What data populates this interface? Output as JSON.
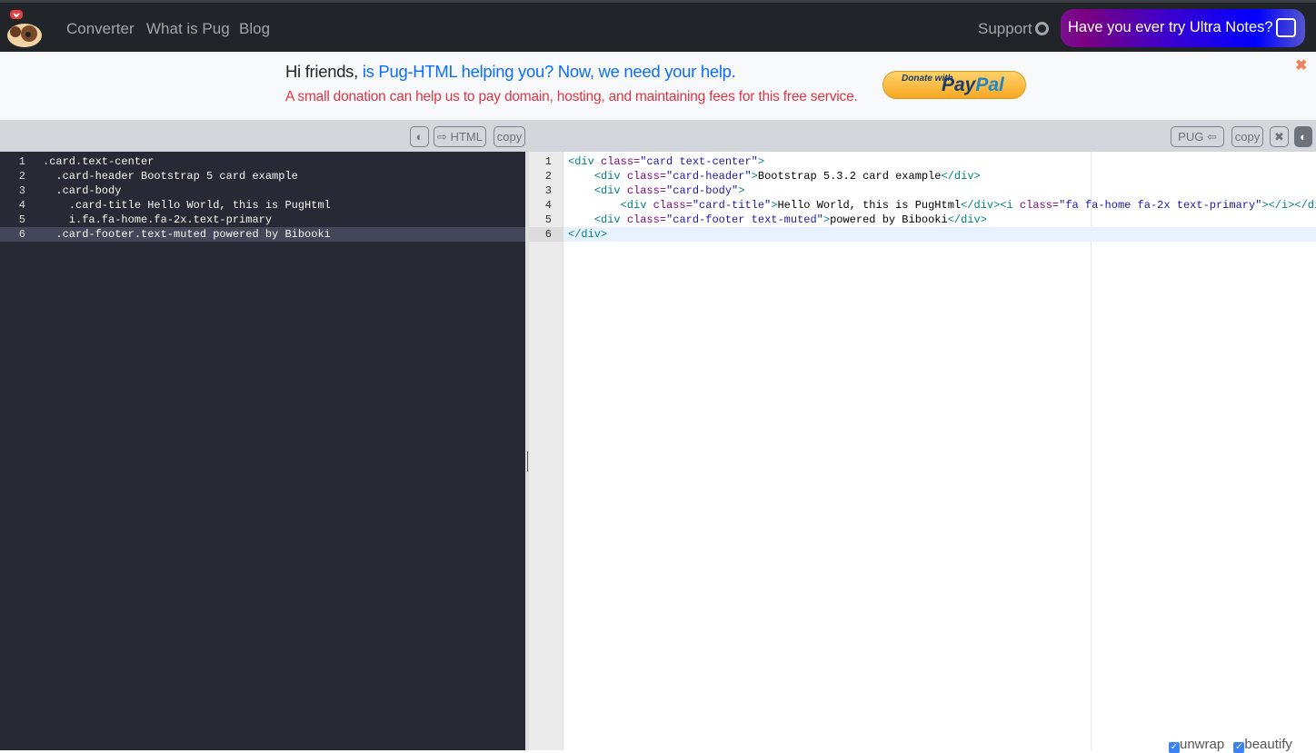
{
  "nav": {
    "links": [
      "Converter",
      "What is Pug",
      "Blog"
    ],
    "support": "Support",
    "ultra_notes": "Have you ever try Ultra Notes?"
  },
  "banner": {
    "greeting": "Hi friends, ",
    "highlight": "is Pug-HTML helping you? Now, we need your help.",
    "message": "A small donation can help us to pay domain, hosting, and maintaining fees for this free service.",
    "paypal_donate": "Donate with",
    "paypal_brand_a": "Pay",
    "paypal_brand_b": "Pal"
  },
  "toolbar": {
    "left_convert": "⇨ HTML",
    "left_copy": "copy",
    "right_convert": "PUG ⇦",
    "right_copy": "copy"
  },
  "pug_editor": {
    "lines": [
      ".card.text-center",
      "  .card-header Bootstrap 5 card example",
      "  .card-body",
      "    .card-title Hello World, this is PugHtml",
      "    i.fa.fa-home.fa-2x.text-primary",
      "  .card-footer.text-muted powered by Bibooki"
    ],
    "active_line": 6
  },
  "html_editor": {
    "active_line": 6,
    "lines": [
      [
        [
          "tag",
          "<div "
        ],
        [
          "attr",
          "class="
        ],
        [
          "str",
          "\"card text-center\""
        ],
        [
          "tag",
          ">"
        ]
      ],
      [
        [
          "text",
          "    "
        ],
        [
          "tag",
          "<div "
        ],
        [
          "attr",
          "class="
        ],
        [
          "str",
          "\"card-header\""
        ],
        [
          "tag",
          ">"
        ],
        [
          "text",
          "Bootstrap 5.3.2 card example"
        ],
        [
          "tag",
          "</div>"
        ]
      ],
      [
        [
          "text",
          "    "
        ],
        [
          "tag",
          "<div "
        ],
        [
          "attr",
          "class="
        ],
        [
          "str",
          "\"card-body\""
        ],
        [
          "tag",
          ">"
        ]
      ],
      [
        [
          "text",
          "        "
        ],
        [
          "tag",
          "<div "
        ],
        [
          "attr",
          "class="
        ],
        [
          "str",
          "\"card-title\""
        ],
        [
          "tag",
          ">"
        ],
        [
          "text",
          "Hello World, this is PugHtml"
        ],
        [
          "tag",
          "</div><i "
        ],
        [
          "attr",
          "class="
        ],
        [
          "str",
          "\"fa fa-home fa-2x text-primary\""
        ],
        [
          "tag",
          "></i></div>"
        ]
      ],
      [
        [
          "text",
          "    "
        ],
        [
          "tag",
          "<div "
        ],
        [
          "attr",
          "class="
        ],
        [
          "str",
          "\"card-footer text-muted\""
        ],
        [
          "tag",
          ">"
        ],
        [
          "text",
          "powered by Bibooki"
        ],
        [
          "tag",
          "</div>"
        ]
      ],
      [
        [
          "tag",
          "</div>"
        ]
      ]
    ]
  },
  "options": {
    "unwrap": "unwrap",
    "beautify": "beautify",
    "unwrap_checked": true,
    "beautify_checked": true
  }
}
